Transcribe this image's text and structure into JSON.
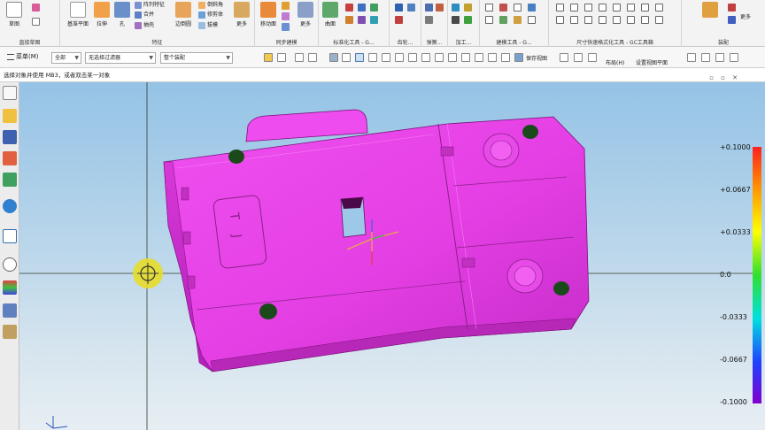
{
  "ribbon": {
    "groups": [
      {
        "label": "直接草图"
      },
      {
        "label": "特征"
      },
      {
        "label": "同步建模"
      },
      {
        "label": "标准化工具 - G..."
      },
      {
        "label": "齿轮..."
      },
      {
        "label": "弹簧..."
      },
      {
        "label": "加工..."
      },
      {
        "label": "建模工具 - G..."
      },
      {
        "label": "尺寸快速格式化工具 - GC工具箱"
      },
      {
        "label": "装配"
      }
    ],
    "buttons": {
      "sketch": "草图",
      "datum_plane": "基准平面",
      "extrude": "拉伸",
      "hole": "孔",
      "pattern_feature": "阵列特征",
      "unite": "合并",
      "shell": "抽壳",
      "edge_blend": "边倒圆",
      "chamfer": "倒斜角",
      "trim_body": "修剪体",
      "draft": "拔模",
      "more_feature": "更多",
      "move_face": "移动面",
      "more_sync": "更多",
      "surface": "曲面",
      "more_assembly": "更多"
    }
  },
  "toolbar": {
    "menu_label": "菜单(M)",
    "filter_all": "全部",
    "selection_filter": "无选择过滤器",
    "assembly_scope": "整个装配",
    "save_view": "保存视图",
    "layout": "布局(H)",
    "set_work_plane": "设置视图平面"
  },
  "status": {
    "prompt": "选择对象并使用 MB3，或者双击某一对象"
  },
  "part": {
    "embossed_text": "T J"
  },
  "legend": {
    "values": [
      "+0.1000",
      "+0.0667",
      "+0.0333",
      "0.0",
      "-0.0333",
      "-0.0667",
      "-0.1000"
    ]
  },
  "colors": {
    "part": "#e43fe4",
    "ribbon_bg": "#f3f3f3",
    "highlight": "#e7dc2a"
  }
}
